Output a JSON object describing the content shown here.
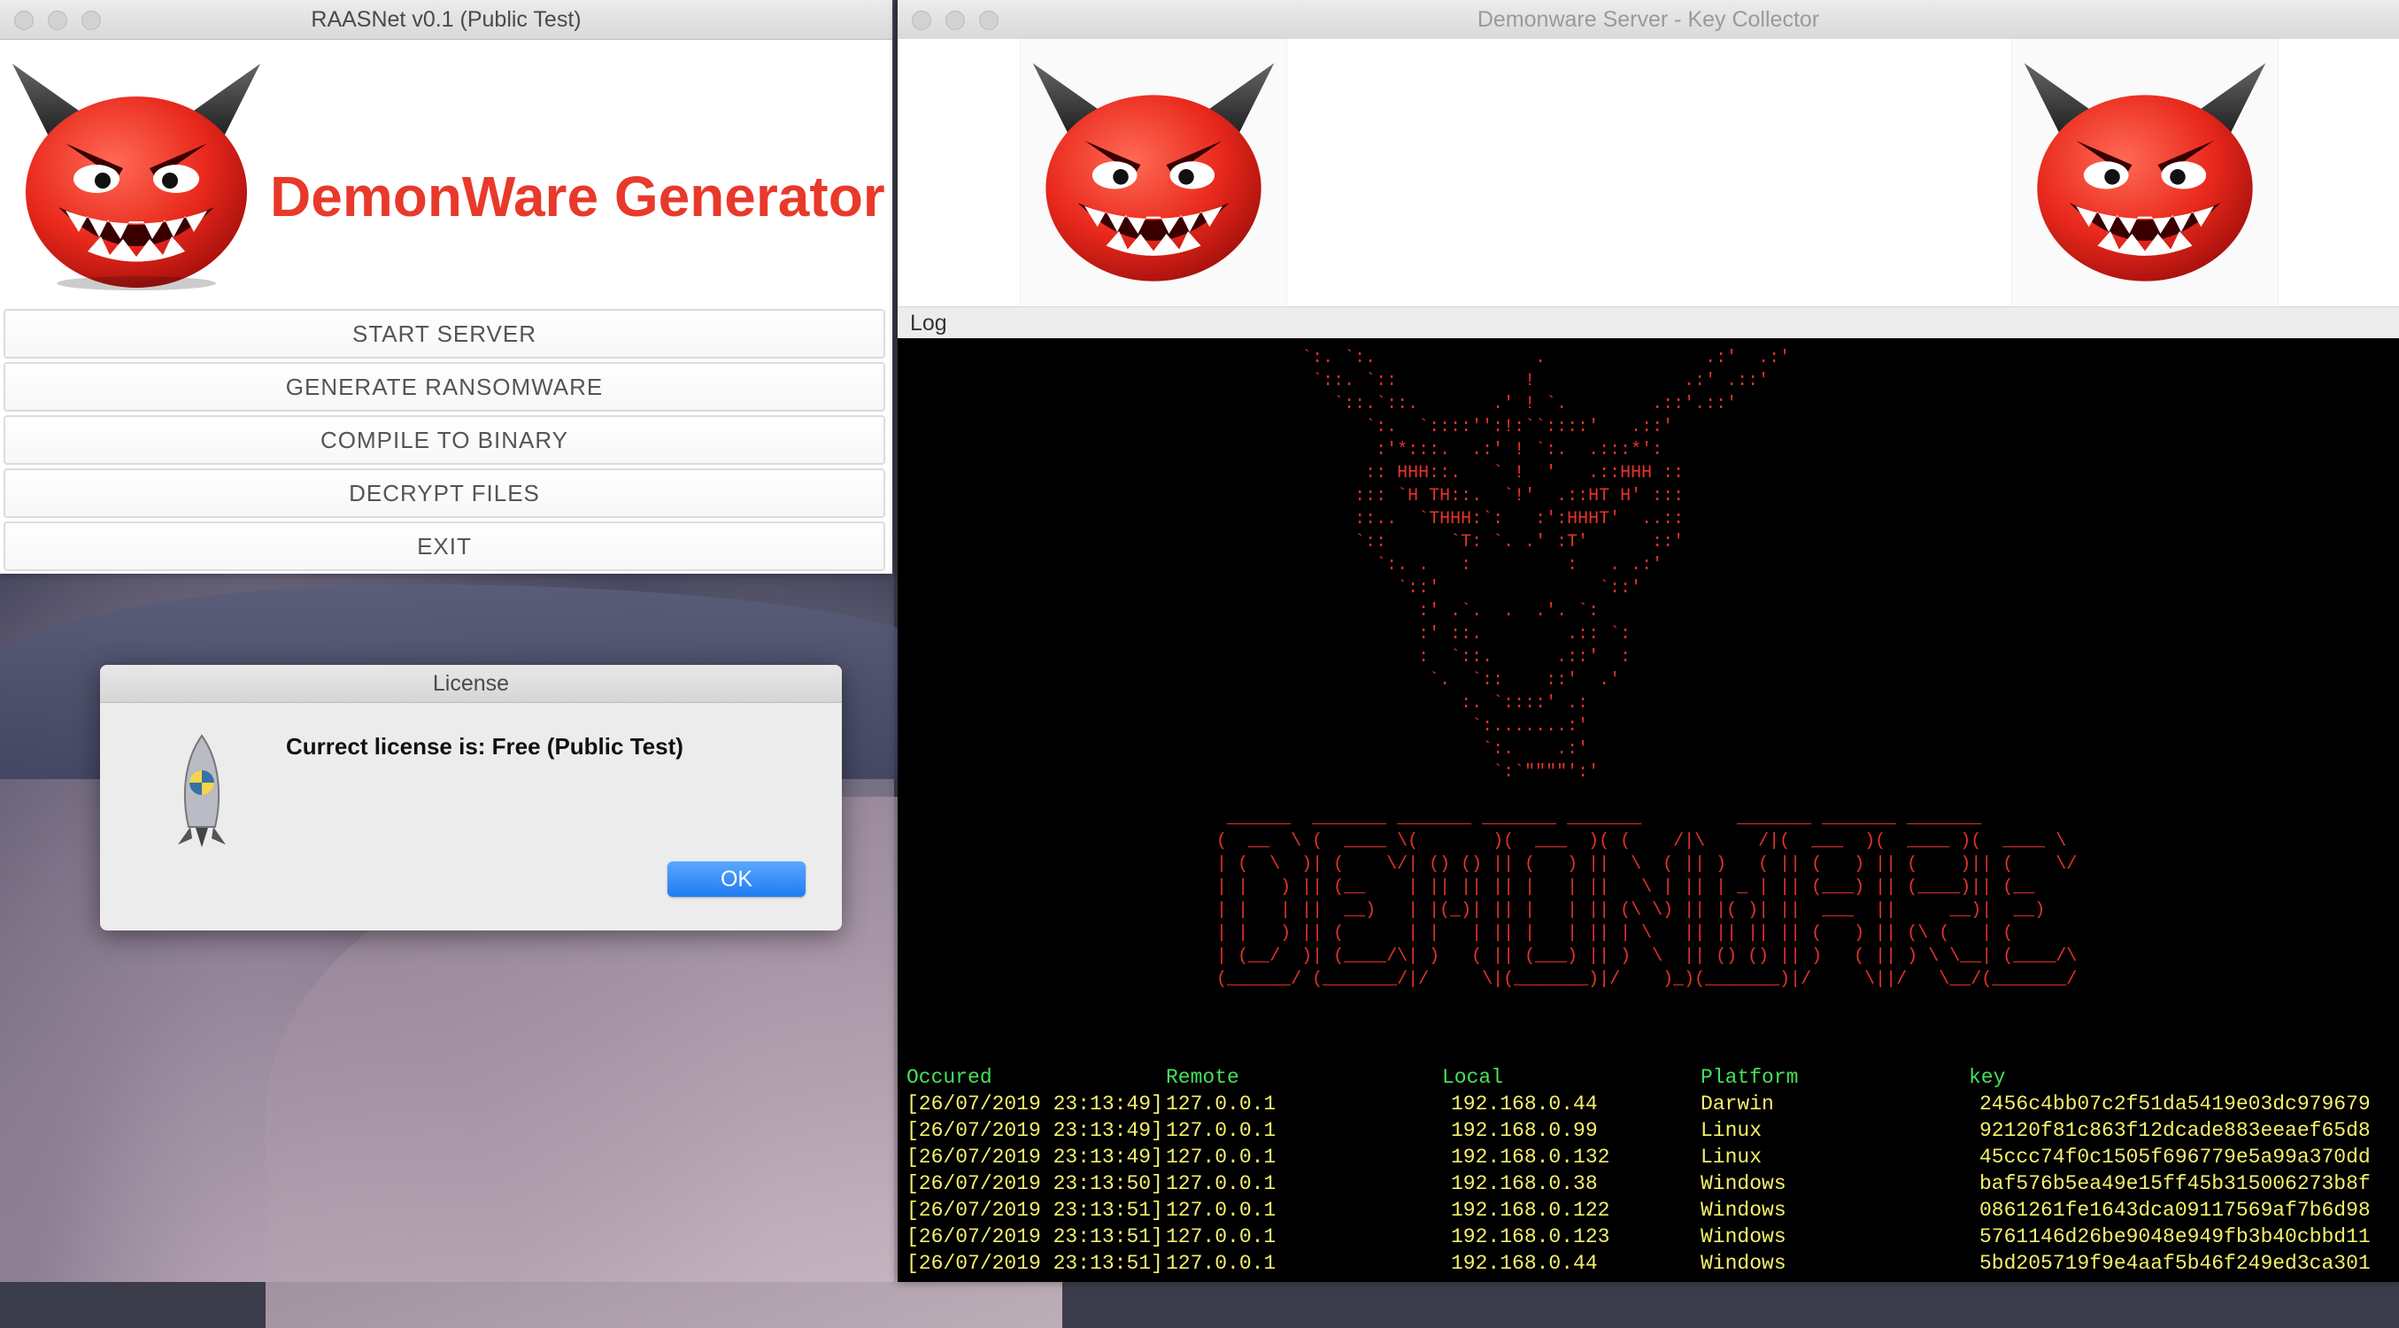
{
  "left_window": {
    "title": "RAASNet v0.1 (Public Test)",
    "generator_title": "DemonWare Generator",
    "buttons": [
      "START SERVER",
      "GENERATE RANSOMWARE",
      "COMPILE TO BINARY",
      "DECRYPT FILES",
      "EXIT"
    ]
  },
  "dialog": {
    "title": "License",
    "message": "Currect license is: Free (Public Test)",
    "ok_label": "OK"
  },
  "right_window": {
    "title": "Demonware Server - Key Collector",
    "log_label": "Log",
    "ascii_art": "                                      `:. `:.               .               .:'  .:'\n                                       `::. `::            !              .:' .::'\n                                         `::.`::.       .' ! `.        .::'.::'\n                                            `:.  `::::'':!:``::::'   .::'\n                                             :'*:::.  .:' ! `:.  .:::*':\n                                            :: HHH::.   ` !  '   .::HHH ::\n                                           ::: `H TH::.  `!'  .::HT H' :::\n                                           ::..  `THHH:`:   :':HHHT'  ..::\n                                           `::      `T: `. .' :T'      ::'\n                                             `:. .   :         :   . .:'\n                                               `::'               `::'\n                                                 :' .`.  .  .'. `:\n                                                 :' ::.        .:: `:\n                                                 :  `::.      .::'  :\n                                                  `.  `::    ::'  .'\n                                                     :. `::::' .:\n                                                      `:.......:'\n                                                       `:.    .:'\n                                                        `:`\"\"\"\"':'\n\n                               ______  _______ _______ _______ _______         _______ _______ _______\n                              (  __  \\ (  ____ \\(       )(  ___  )( (    /|\\     /|(  ___  )(  ____ )(  ____ \\\n                              | (  \\  )| (    \\/| () () || (   ) ||  \\  ( || )   ( || (   ) || (    )|| (    \\/\n                              | |   ) || (__    | || || || |   | ||   \\ | || | _ | || (___) || (____)|| (__\n                              | |   | ||  __)   | |(_)| || |   | || (\\ \\) || |( )| ||  ___  ||     __)|  __)\n                              | |   ) || (      | |   | || |   | || | \\   || || || || (   ) || (\\ (   | (\n                              | (__/  )| (____/\\| )   ( || (___) || )  \\  || () () || )   ( || ) \\ \\__| (____/\\\n                              (______/ (_______/|/     \\|(_______)|/    )_)(_______)|/     \\||/   \\__/(_______/",
    "log_headers": [
      "Occured",
      "Remote",
      "Local",
      "Platform",
      "key"
    ],
    "log_rows": [
      [
        "[26/07/2019 23:13:49]",
        "127.0.0.1",
        "192.168.0.44",
        "Darwin",
        "2456c4bb07c2f51da5419e03dc979679"
      ],
      [
        "[26/07/2019 23:13:49]",
        "127.0.0.1",
        "192.168.0.99",
        "Linux",
        "92120f81c863f12dcade883eeaef65d8"
      ],
      [
        "[26/07/2019 23:13:49]",
        "127.0.0.1",
        "192.168.0.132",
        "Linux",
        "45ccc74f0c1505f696779e5a99a370dd"
      ],
      [
        "[26/07/2019 23:13:50]",
        "127.0.0.1",
        "192.168.0.38",
        "Windows",
        "baf576b5ea49e15ff45b315006273b8f"
      ],
      [
        "[26/07/2019 23:13:51]",
        "127.0.0.1",
        "192.168.0.122",
        "Windows",
        "0861261fe1643dca09117569af7b6d98"
      ],
      [
        "[26/07/2019 23:13:51]",
        "127.0.0.1",
        "192.168.0.123",
        "Windows",
        "5761146d26be9048e949fb3b40cbbd11"
      ],
      [
        "[26/07/2019 23:13:51]",
        "127.0.0.1",
        "192.168.0.44",
        "Windows",
        "5bd205719f9e4aaf5b46f249ed3ca301"
      ]
    ]
  },
  "colors": {
    "brand_red": "#e8392a",
    "terminal_bg": "#000000",
    "ascii_red": "#e6332a",
    "log_header": "#45e05a",
    "log_row": "#f4f06a",
    "ok_button": "#1f7bf2"
  },
  "icons": {
    "devil_logo": "devil-icon",
    "dialog_icon": "python-rocket-icon"
  }
}
